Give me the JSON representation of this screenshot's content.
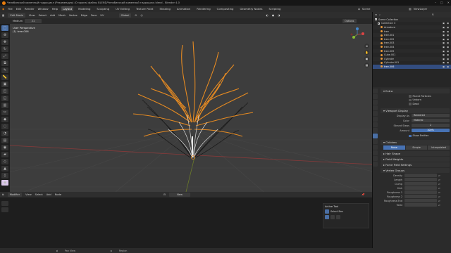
{
  "window": {
    "title": "Челябинский каменный гидроцикл (Рекомендую) (Сторона) файлы BLEND/Челябинский каменный гидроцикл.blend - Blender 4.0"
  },
  "menubar": {
    "menus": [
      "File",
      "Edit",
      "Render",
      "Window",
      "Help"
    ],
    "workspaces": [
      "Layout",
      "Modeling",
      "Sculpting",
      "UV Editing",
      "Texture Paint",
      "Shading",
      "Animation",
      "Rendering",
      "Compositing",
      "Geometry Nodes",
      "Scripting"
    ],
    "active_workspace": "Layout",
    "scene": "Scene",
    "view_layer": "ViewLayer"
  },
  "viewport_header": {
    "mode": "Edit Mode",
    "menus": [
      "View",
      "Select",
      "Add",
      "Mesh",
      "Vertex",
      "Edge",
      "Face",
      "UV"
    ],
    "orientation": "Global",
    "options": "Options"
  },
  "tool_row": {
    "tool": "Medium",
    "value": "21"
  },
  "viewport": {
    "label1": "User Perspective",
    "label2": "(1) tree.006"
  },
  "node_editor": {
    "mode": "Modifier",
    "menus": [
      "View",
      "Select",
      "Add",
      "Node"
    ],
    "new_label": "New"
  },
  "active_tool": {
    "title": "Active Tool",
    "select_label": "Select Box"
  },
  "status": {
    "left": "Pan View",
    "right": "Region"
  },
  "outliner": {
    "title": "Scene Collection",
    "rows": [
      {
        "name": "Collection 3",
        "type": "col"
      },
      {
        "name": "Armature",
        "type": "ob"
      },
      {
        "name": "tree",
        "type": "ob"
      },
      {
        "name": "tree.001",
        "type": "ob"
      },
      {
        "name": "tree.002",
        "type": "ob"
      },
      {
        "name": "tree.003",
        "type": "ob"
      },
      {
        "name": "tree.004",
        "type": "ob"
      },
      {
        "name": "tree.005",
        "type": "ob"
      },
      {
        "name": "Cube.001",
        "type": "ob"
      },
      {
        "name": "Cylinder",
        "type": "ob"
      },
      {
        "name": "Cylinder.001",
        "type": "ob"
      },
      {
        "name": "tree.006",
        "type": "ob",
        "selected": true
      }
    ]
  },
  "properties": {
    "extra": "Extra",
    "extra_checks": [
      {
        "label": "Parent Particles",
        "on": false
      },
      {
        "label": "Unborn",
        "on": false
      },
      {
        "label": "Dead",
        "on": false
      }
    ],
    "viewport_display": "Viewport Display",
    "display_as_label": "Display As",
    "display_as_value": "Rendered",
    "color_label": "Color",
    "color_value": "Material",
    "strand_steps_label": "Strand Steps",
    "strand_steps_value": "2",
    "amount_label": "Amount",
    "amount_value": "100%",
    "show_emitter": "Show Emitter",
    "children": "Children",
    "children_modes": [
      "None",
      "Simple",
      "Interpolated"
    ],
    "children_active": "None",
    "sections": [
      "Hair Shape",
      "Field Weights",
      "Force Field Settings",
      "Vertex Groups"
    ],
    "vertex_groups": [
      "Density",
      "Length",
      "Clump",
      "Kink",
      "Roughness 1",
      "Roughness 2",
      "Roughness End",
      "Twist"
    ]
  }
}
